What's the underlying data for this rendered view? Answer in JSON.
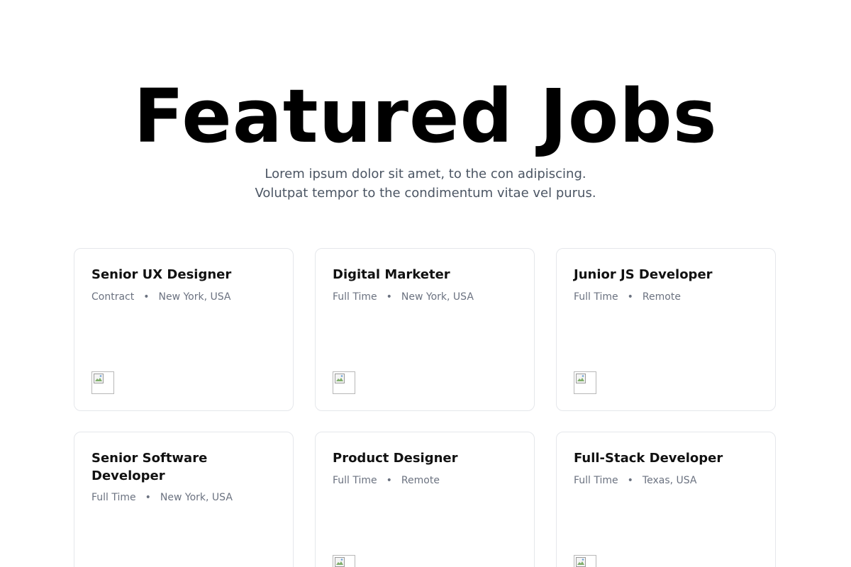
{
  "hero": {
    "title": "Featured Jobs",
    "subtitle_line1": "Lorem ipsum dolor sit amet, to the con adipiscing.",
    "subtitle_line2": "Volutpat tempor to the condimentum vitae vel purus."
  },
  "jobs": [
    {
      "title": "Senior UX Designer",
      "type": "Contract",
      "separator": "•",
      "location": "New York, USA",
      "logo_icon": "broken-image-icon"
    },
    {
      "title": "Digital Marketer",
      "type": "Full Time",
      "separator": "•",
      "location": "New York, USA",
      "logo_icon": "broken-image-icon"
    },
    {
      "title": "Junior JS Developer",
      "type": "Full Time",
      "separator": "•",
      "location": "Remote",
      "logo_icon": "broken-image-icon"
    },
    {
      "title": "Senior Software Developer",
      "type": "Full Time",
      "separator": "•",
      "location": "New York, USA",
      "logo_icon": "broken-image-icon"
    },
    {
      "title": "Product Designer",
      "type": "Full Time",
      "separator": "•",
      "location": "Remote",
      "logo_icon": "broken-image-icon"
    },
    {
      "title": "Full-Stack Developer",
      "type": "Full Time",
      "separator": "•",
      "location": "Texas, USA",
      "logo_icon": "broken-image-icon"
    }
  ]
}
